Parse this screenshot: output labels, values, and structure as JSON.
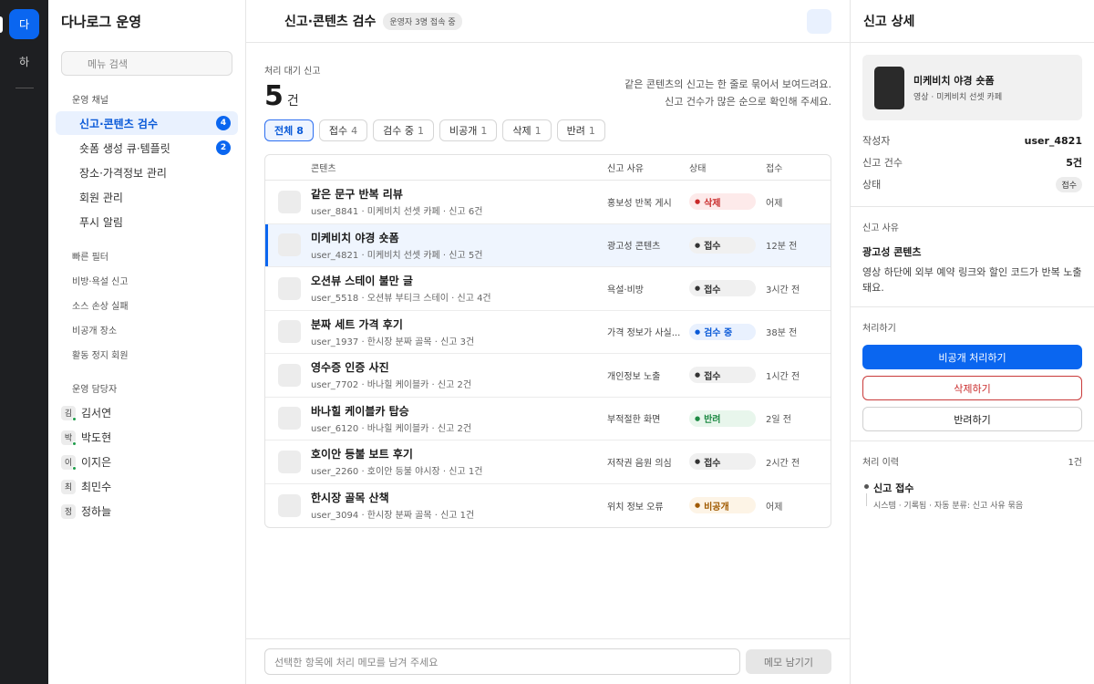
{
  "rail": {
    "active_ws": "다",
    "other_ws": "하"
  },
  "sidebar": {
    "title": "다나로그 운영",
    "search_placeholder": "메뉴 검색",
    "channel_label": "운영 채널",
    "channels": [
      {
        "label": "신고·콘텐츠 검수",
        "badge": "4"
      },
      {
        "label": "숏폼 생성 큐·템플릿",
        "badge": "2"
      },
      {
        "label": "장소·가격정보 관리"
      },
      {
        "label": "회원 관리"
      },
      {
        "label": "푸시 알림"
      }
    ],
    "filter_label": "빠른 필터",
    "filters": [
      "비방·욕설 신고",
      "소스 손상 실패",
      "비공개 장소",
      "활동 정지 회원"
    ],
    "staff_label": "운영 담당자",
    "staff": [
      {
        "initial": "김",
        "name": "김서연"
      },
      {
        "initial": "박",
        "name": "박도현"
      },
      {
        "initial": "이",
        "name": "이지은"
      },
      {
        "initial": "최",
        "name": "최민수"
      },
      {
        "initial": "정",
        "name": "정하늘"
      }
    ]
  },
  "main": {
    "title": "신고·콘텐츠 검수",
    "online": "운영자 3명 접속 중",
    "queue_label": "처리 대기 신고",
    "count": "5",
    "count_unit": "건",
    "hint_line1": "같은 콘텐츠의 신고는 한 줄로 묶어서 보여드려요.",
    "hint_line2": "신고 건수가 많은 순으로 확인해 주세요.",
    "tabs": [
      {
        "label": "전체",
        "n": "8"
      },
      {
        "label": "접수",
        "n": "4"
      },
      {
        "label": "검수 중",
        "n": "1"
      },
      {
        "label": "비공개",
        "n": "1"
      },
      {
        "label": "삭제",
        "n": "1"
      },
      {
        "label": "반려",
        "n": "1"
      }
    ],
    "columns": {
      "content": "콘텐츠",
      "reason": "신고 사유",
      "status": "상태",
      "received": "접수"
    },
    "rows": [
      {
        "title": "같은 문구 반복 리뷰",
        "sub": "user_8841 · 미케비치 선셋 카페 · 신고 6건",
        "reason": "홍보성 반복 게시",
        "status": "삭제",
        "time": "어제"
      },
      {
        "title": "미케비치 야경 숏폼",
        "sub": "user_4821 · 미케비치 선셋 카페 · 신고 5건",
        "reason": "광고성 콘텐츠",
        "status": "접수",
        "time": "12분 전"
      },
      {
        "title": "오션뷰 스테이 불만 글",
        "sub": "user_5518 · 오션뷰 부티크 스테이 · 신고 4건",
        "reason": "욕설·비방",
        "status": "접수",
        "time": "3시간 전"
      },
      {
        "title": "분짜 세트 가격 후기",
        "sub": "user_1937 · 한시장 분짜 골목 · 신고 3건",
        "reason": "가격 정보가 사실...",
        "status": "검수 중",
        "time": "38분 전"
      },
      {
        "title": "영수증 인증 사진",
        "sub": "user_7702 · 바나힐 케이블카 · 신고 2건",
        "reason": "개인정보 노출",
        "status": "접수",
        "time": "1시간 전"
      },
      {
        "title": "바나힐 케이블카 탑승",
        "sub": "user_6120 · 바나힐 케이블카 · 신고 2건",
        "reason": "부적절한 화면",
        "status": "반려",
        "time": "2일 전"
      },
      {
        "title": "호이안 등불 보트 후기",
        "sub": "user_2260 · 호이안 등불 야시장 · 신고 1건",
        "reason": "저작권 음원 의심",
        "status": "접수",
        "time": "2시간 전"
      },
      {
        "title": "한시장 골목 산책",
        "sub": "user_3094 · 한시장 분짜 골목 · 신고 1건",
        "reason": "위치 정보 오류",
        "status": "비공개",
        "time": "어제"
      }
    ],
    "memo_placeholder": "선택한 항목에 처리 메모를 남겨 주세요",
    "memo_button": "메모 남기기"
  },
  "detail": {
    "title": "신고 상세",
    "card_title": "미케비치 야경 숏폼",
    "card_sub": "영상 · 미케비치 선셋 카페",
    "author_label": "작성자",
    "author": "user_4821",
    "count_label": "신고 건수",
    "count": "5건",
    "status_label": "상태",
    "status": "접수",
    "reason_label": "신고 사유",
    "reason_title": "광고성 콘텐츠",
    "reason_text": "영상 하단에 외부 예약 링크와 할인 코드가 반복 노출돼요.",
    "action_label": "처리하기",
    "btn_private": "비공개 처리하기",
    "btn_delete": "삭제하기",
    "btn_reject": "반려하기",
    "history_label": "처리 이력",
    "history_count": "1건",
    "history_title": "신고 접수",
    "history_sub": "시스템 · 기록됨 · 자동 분류: 신고 사유 묶음"
  }
}
